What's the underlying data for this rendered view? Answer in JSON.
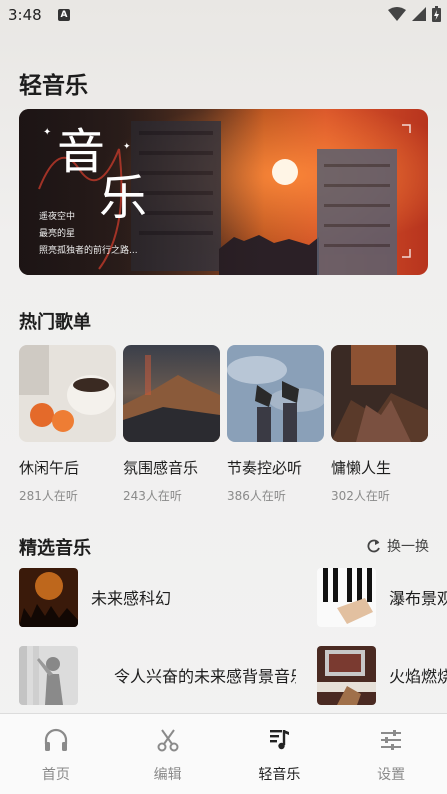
{
  "status_bar": {
    "time": "3:48",
    "badge": "A"
  },
  "app_title": "轻音乐",
  "banner": {
    "title_line1": "音",
    "title_line2": "乐",
    "sub_line1": "遥夜空中",
    "sub_line2": "最亮的星",
    "sub_line3": "照亮孤独者的前行之路..."
  },
  "hot_playlists": {
    "title": "热门歌单",
    "items": [
      {
        "name": "休闲午后",
        "listeners": "281人在听"
      },
      {
        "name": "氛围感音乐",
        "listeners": "243人在听"
      },
      {
        "name": "节奏控必听",
        "listeners": "386人在听"
      },
      {
        "name": "慵懒人生",
        "listeners": "302人在听"
      }
    ]
  },
  "featured": {
    "title": "精选音乐",
    "refresh_label": "换一换",
    "items": [
      {
        "name": "未来感科幻"
      },
      {
        "name": "瀑布景观"
      },
      {
        "name": "令人兴奋的未来感背景音乐"
      },
      {
        "name": "火焰燃烧"
      }
    ]
  },
  "nav": {
    "items": [
      {
        "label": "首页",
        "icon": "headphones-icon"
      },
      {
        "label": "编辑",
        "icon": "scissors-icon"
      },
      {
        "label": "轻音乐",
        "icon": "music-note-icon"
      },
      {
        "label": "设置",
        "icon": "sliders-icon"
      }
    ],
    "active": "轻音乐"
  }
}
